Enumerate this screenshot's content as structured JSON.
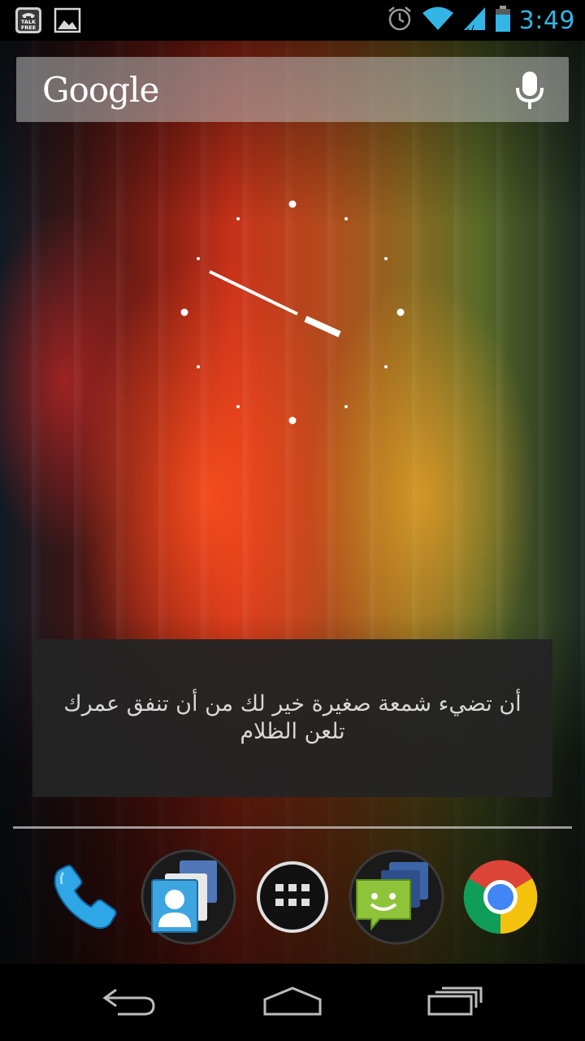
{
  "status_bar": {
    "notification_icons": [
      "talkfree-icon",
      "gallery-image-icon"
    ],
    "talkfree_badge_lines": [
      "TALK",
      "FREE"
    ],
    "system_icons": [
      "alarm-icon",
      "wifi-icon",
      "signal-icon",
      "battery-icon"
    ],
    "time": "3:49",
    "accent_color": "#33b5e5"
  },
  "search_widget": {
    "logo_text": "Google",
    "voice_icon": "mic-icon"
  },
  "clock_widget": {
    "type": "analog",
    "time_shown": "3:49"
  },
  "quote_widget": {
    "text": "أن تضيء شمعة صغيرة خير لك من أن تنفق عمرك تلعن الظلام"
  },
  "dock": {
    "items": [
      {
        "name": "phone",
        "icon": "phone-icon"
      },
      {
        "name": "contacts",
        "icon": "contacts-icon"
      },
      {
        "name": "all-apps",
        "icon": "app-drawer-icon"
      },
      {
        "name": "messaging",
        "icon": "messaging-icon"
      },
      {
        "name": "chrome",
        "icon": "chrome-icon"
      }
    ]
  },
  "nav_bar": {
    "buttons": [
      "back-icon",
      "home-icon",
      "recent-apps-icon"
    ]
  }
}
